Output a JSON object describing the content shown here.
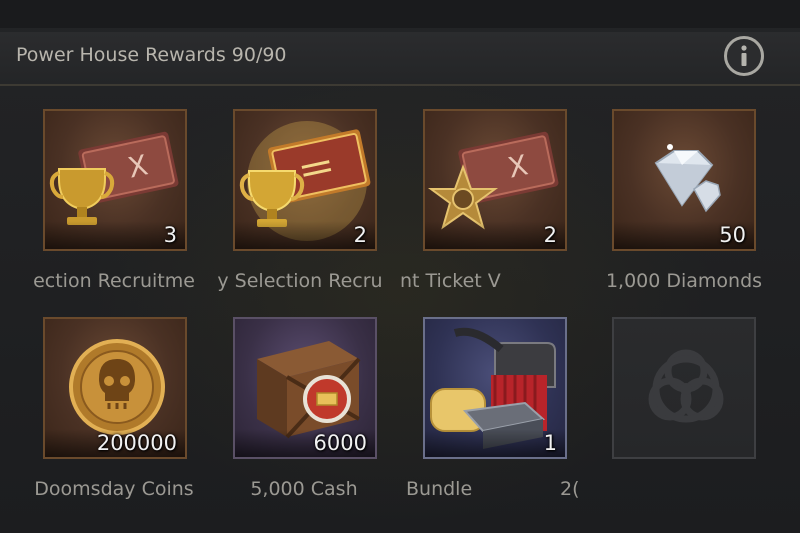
{
  "header": {
    "title": "Power House Rewards 90/90"
  },
  "rewards": [
    {
      "qty": "3",
      "label": "ection Recruitme",
      "icon": "trophy-ticket-icon"
    },
    {
      "qty": "2",
      "label": "y Selection Recru",
      "icon": "trophy-ticket-golden-icon"
    },
    {
      "qty": "2",
      "label": "nt Ticket V",
      "icon": "star-ticket-icon"
    },
    {
      "qty": "50",
      "label": "1,000 Diamonds",
      "icon": "diamond-icon"
    },
    {
      "qty": "200000",
      "label": "Doomsday Coins",
      "icon": "skull-coin-icon"
    },
    {
      "qty": "6000",
      "label": "5,000 Cash",
      "icon": "cash-crate-icon"
    },
    {
      "qty": "1",
      "label": "Bundle",
      "icon": "resource-bundle-icon"
    },
    {
      "qty": "",
      "label": "2(",
      "icon": "biohazard-icon"
    }
  ],
  "colors": {
    "accent_border": "#6a4a2c",
    "text": "#9b9993",
    "qty_text": "#f2f2f2"
  }
}
